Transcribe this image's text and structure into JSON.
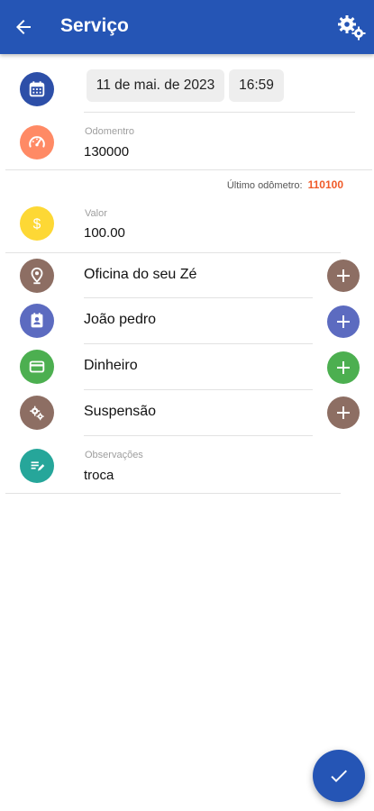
{
  "header": {
    "title": "Serviço",
    "back_icon": "arrow-left-icon",
    "settings_icon": "gears-icon"
  },
  "datetime": {
    "date": "11 de mai. de 2023",
    "time": "16:59"
  },
  "odometer": {
    "label": "Odomentro",
    "value": "130000",
    "last_label": "Último odômetro:",
    "last_value": "110100"
  },
  "price": {
    "label": "Valor",
    "value": "100.00"
  },
  "items": [
    {
      "text": "Oficina do seu Zé",
      "icon": "location-pin-icon",
      "color": "#8d6e63"
    },
    {
      "text": "João pedro",
      "icon": "contact-card-icon",
      "color": "#5c6bc0"
    },
    {
      "text": "Dinheiro",
      "icon": "credit-card-icon",
      "color": "#4caf50"
    },
    {
      "text": "Suspensão",
      "icon": "gears-icon",
      "color": "#8d6e63"
    }
  ],
  "notes": {
    "label": "Observações",
    "value": "troca"
  },
  "colors": {
    "primary": "#2555b5",
    "calendar": "#2d4fa8",
    "odometer": "#ff8a65",
    "price": "#fdd835",
    "notes": "#26a69a",
    "last_odometer_value": "#f05a28"
  }
}
